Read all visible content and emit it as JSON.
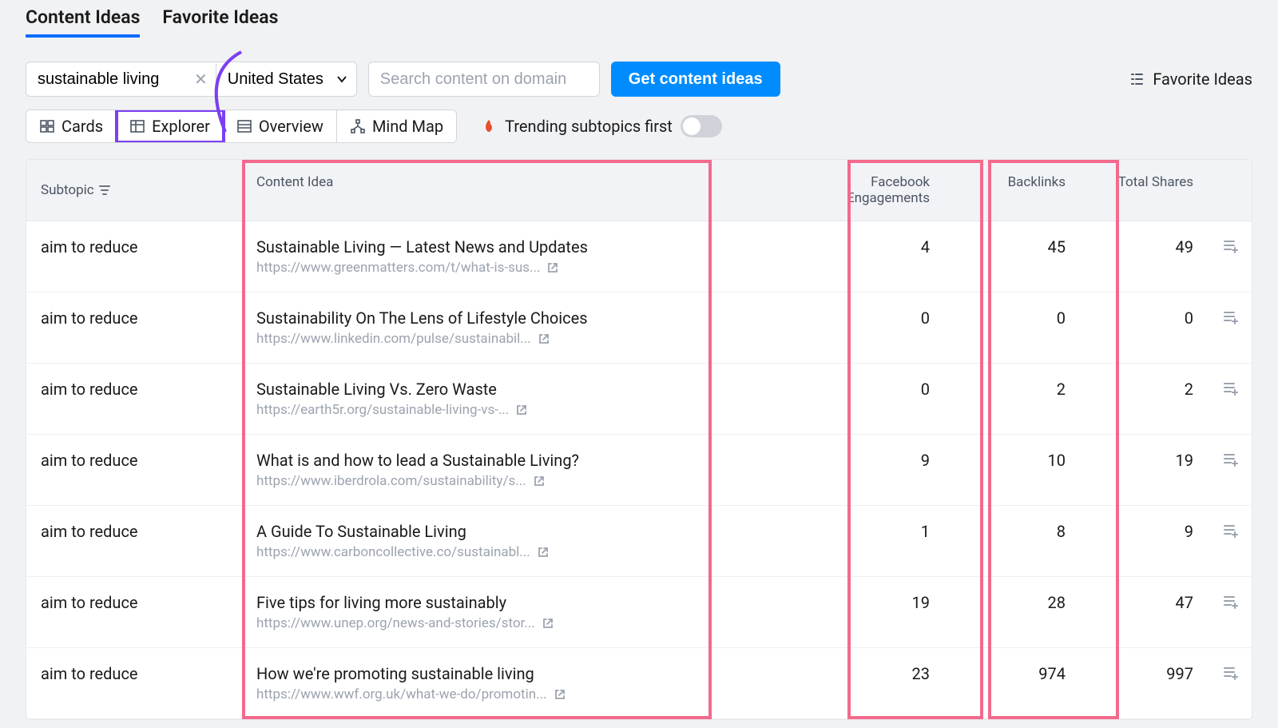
{
  "tabs": {
    "content_ideas": "Content Ideas",
    "favorite_ideas": "Favorite Ideas"
  },
  "toolbar": {
    "topic_value": "sustainable living",
    "country_value": "United States",
    "domain_placeholder": "Search content on domain",
    "get_ideas_label": "Get content ideas",
    "favorite_link": "Favorite Ideas"
  },
  "views": {
    "cards": "Cards",
    "explorer": "Explorer",
    "overview": "Overview",
    "mindmap": "Mind Map",
    "trending_label": "Trending subtopics first"
  },
  "columns": {
    "subtopic": "Subtopic",
    "idea": "Content Idea",
    "fb_line1": "Facebook",
    "fb_line2": "Engagements",
    "backlinks": "Backlinks",
    "total_shares": "Total Shares"
  },
  "rows": [
    {
      "subtopic": "aim to reduce",
      "title": "Sustainable Living — Latest News and Updates",
      "url": "https://www.greenmatters.com/t/what-is-sus...",
      "fb": "4",
      "bl": "45",
      "ts": "49"
    },
    {
      "subtopic": "aim to reduce",
      "title": "Sustainability On The Lens of Lifestyle Choices",
      "url": "https://www.linkedin.com/pulse/sustainabil...",
      "fb": "0",
      "bl": "0",
      "ts": "0"
    },
    {
      "subtopic": "aim to reduce",
      "title": "Sustainable Living Vs. Zero Waste",
      "url": "https://earth5r.org/sustainable-living-vs-...",
      "fb": "0",
      "bl": "2",
      "ts": "2"
    },
    {
      "subtopic": "aim to reduce",
      "title": "What is and how to lead a Sustainable Living?",
      "url": "https://www.iberdrola.com/sustainability/s...",
      "fb": "9",
      "bl": "10",
      "ts": "19"
    },
    {
      "subtopic": "aim to reduce",
      "title": "A Guide To Sustainable Living",
      "url": "https://www.carboncollective.co/sustainabl...",
      "fb": "1",
      "bl": "8",
      "ts": "9"
    },
    {
      "subtopic": "aim to reduce",
      "title": "Five tips for living more sustainably",
      "url": "https://www.unep.org/news-and-stories/stor...",
      "fb": "19",
      "bl": "28",
      "ts": "47"
    },
    {
      "subtopic": "aim to reduce",
      "title": "How we're promoting sustainable living",
      "url": "https://www.wwf.org.uk/what-we-do/promotin...",
      "fb": "23",
      "bl": "974",
      "ts": "997"
    }
  ]
}
